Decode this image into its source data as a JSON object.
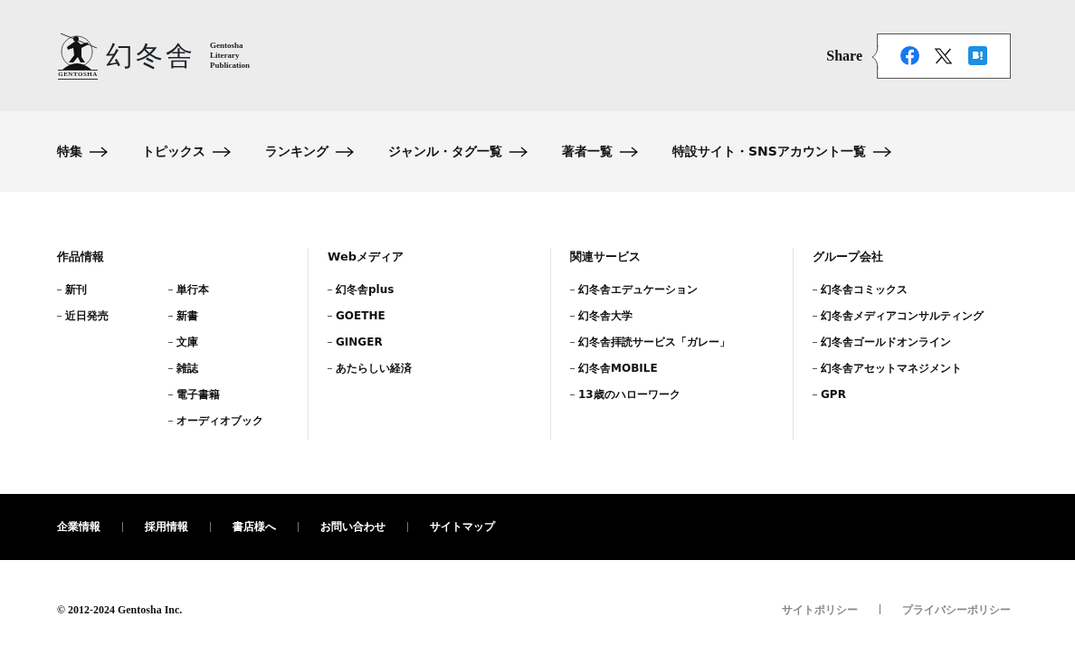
{
  "header": {
    "logo": {
      "kanji": "幻冬舎",
      "wordmark": "GENTOSHA",
      "tagline": [
        "Gentosha",
        "Literary",
        "Publication"
      ]
    },
    "share": {
      "label": "Share"
    }
  },
  "nav": [
    "特集",
    "トピックス",
    "ランキング",
    "ジャンル・タグ一覧",
    "著者一覧",
    "特設サイト・SNSアカウント一覧"
  ],
  "sections": [
    {
      "title": "作品情報",
      "lists": [
        [
          "新刊",
          "近日発売"
        ],
        [
          "単行本",
          "新書",
          "文庫",
          "雑誌",
          "電子書籍",
          "オーディオブック"
        ]
      ]
    },
    {
      "title": "Webメディア",
      "lists": [
        [
          "幻冬舎plus",
          "GOETHE",
          "GINGER",
          "あたらしい経済"
        ]
      ]
    },
    {
      "title": "関連サービス",
      "lists": [
        [
          "幻冬舎エデュケーション",
          "幻冬舎大学",
          "幻冬舎拝読サービス「ガレー」",
          "幻冬舎MOBILE",
          "13歳のハローワーク"
        ]
      ]
    },
    {
      "title": "グループ会社",
      "lists": [
        [
          "幻冬舎コミックス",
          "幻冬舎メディアコンサルティング",
          "幻冬舎ゴールドオンライン",
          "幻冬舎アセットマネジメント",
          "GPR"
        ]
      ]
    }
  ],
  "footer_links": [
    "企業情報",
    "採用情報",
    "書店様へ",
    "お問い合わせ",
    "サイトマップ"
  ],
  "copyright": "© 2012-2024 Gentosha Inc.",
  "policy_links": [
    "サイトポリシー",
    "プライバシーポリシー"
  ]
}
